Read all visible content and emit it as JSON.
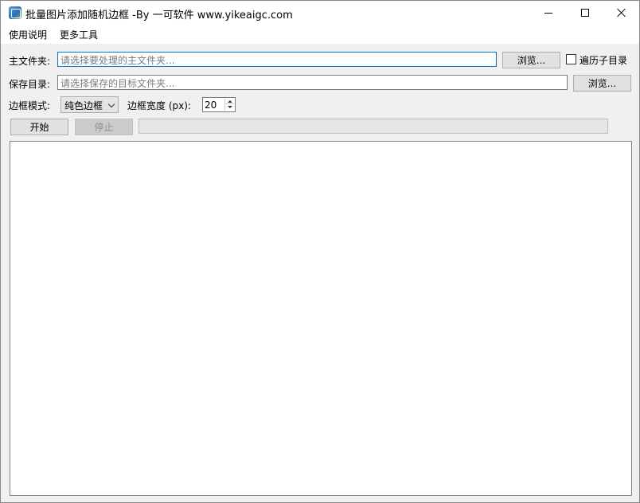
{
  "window": {
    "title": "批量图片添加随机边框 -By 一可软件 www.yikeaigc.com"
  },
  "menu": {
    "help": "使用说明",
    "tools": "更多工具"
  },
  "form": {
    "main_folder": {
      "label": "主文件夹:",
      "placeholder": "请选择要处理的主文件夹...",
      "browse": "浏览..."
    },
    "recursive": {
      "label": "遍历子目录",
      "checked": false
    },
    "save_dir": {
      "label": "保存目录:",
      "placeholder": "请选择保存的目标文件夹...",
      "browse": "浏览..."
    },
    "border_mode": {
      "label": "边框模式:",
      "value": "纯色边框"
    },
    "border_width": {
      "label": "边框宽度 (px):",
      "value": "20"
    }
  },
  "actions": {
    "start": "开始",
    "stop": "停止"
  },
  "progress": {
    "value": 0
  },
  "log": {
    "text": ""
  }
}
